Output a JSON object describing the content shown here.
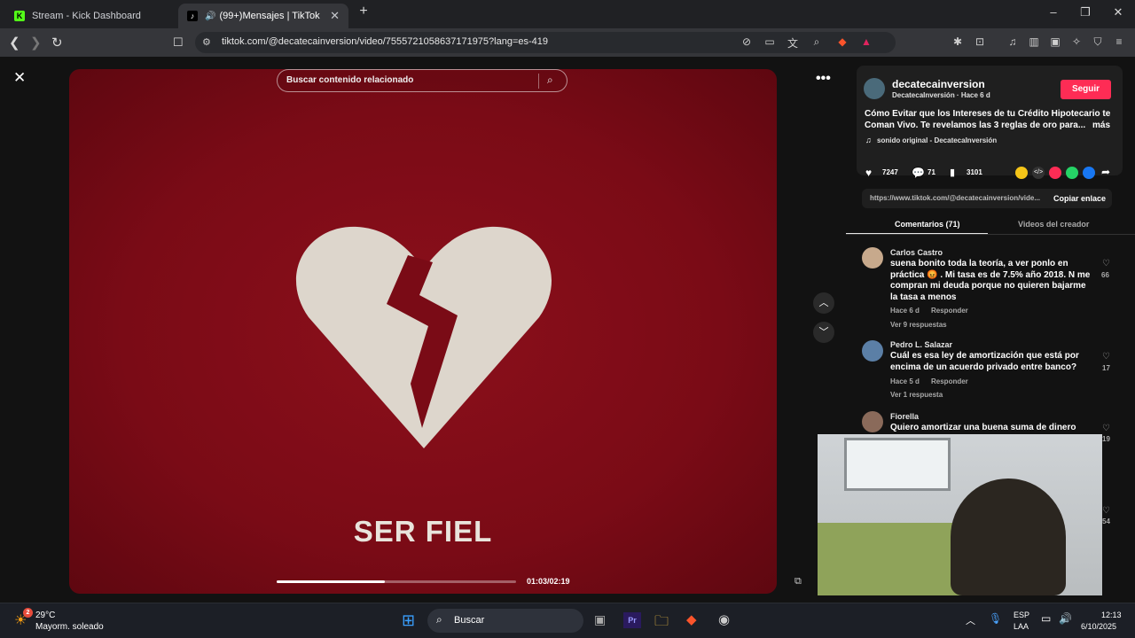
{
  "tabs": [
    {
      "title": "Stream - Kick Dashboard",
      "favicon": "kick-icon"
    },
    {
      "title": "(99+)Mensajes | TikTok",
      "favicon": "tiktok-icon"
    }
  ],
  "address_bar": {
    "url": "tiktok.com/@decatecainversion/video/7555721058637171975?lang=es-419"
  },
  "video": {
    "search_placeholder": "Buscar contenido relacionado",
    "overlay_text": "SER FIEL",
    "time": "01:03/02:19",
    "progress": 0.45
  },
  "creator": {
    "handle": "decatecainversion",
    "subtitle": "DecatecaInversión · Hace 6 d",
    "follow_label": "Seguir",
    "description_line1": "Cómo Evitar que los Intereses de tu Crédito Hipotecario te",
    "description_line2": "Coman Vivo. Te revelamos las 3 reglas de oro para...",
    "more_label": "más",
    "sound": "sonido original - DecatecaInversión"
  },
  "stats": {
    "likes": "7247",
    "comments": "71",
    "saves": "3101"
  },
  "link": {
    "url": "https://www.tiktok.com/@decatecainversion/vide...",
    "copy_label": "Copiar enlace"
  },
  "panel_tabs": {
    "comments": "Comentarios (71)",
    "creator_videos": "Videos del creador"
  },
  "comments": [
    {
      "name": "Carlos Castro",
      "text": "suena bonito toda la teoría, a ver ponlo en práctica 😡 . Mi tasa es de 7.5% año 2018. N me compran mi deuda porque no quieren bajarme la tasa a menos",
      "time": "Hace 6 d",
      "reply": "Responder",
      "replies": "Ver 9 respuestas",
      "likes": "66"
    },
    {
      "name": "Pedro L. Salazar",
      "text": "Cuál es esa ley de amortización que está por encima de un acuerdo privado entre banco?",
      "time": "Hace 5 d",
      "reply": "Responder",
      "replies": "Ver 1 respuesta",
      "likes": "17"
    },
    {
      "name": "Fiorella",
      "text": "Quiero amortizar una buena suma de dinero pero",
      "likes": "19"
    }
  ],
  "hidden_likes": "54",
  "taskbar": {
    "weather_temp": "29°C",
    "weather_desc": "Mayorm. soleado",
    "weather_badge": "2",
    "search_label": "Buscar",
    "lang": "ESP",
    "lang2": "LAA",
    "clock_time": "12:13",
    "clock_date": "6/10/2025"
  },
  "colors": {
    "follow": "#fe2c55",
    "video_bg": "#7a0b16",
    "heart": "#ddd6cc"
  }
}
